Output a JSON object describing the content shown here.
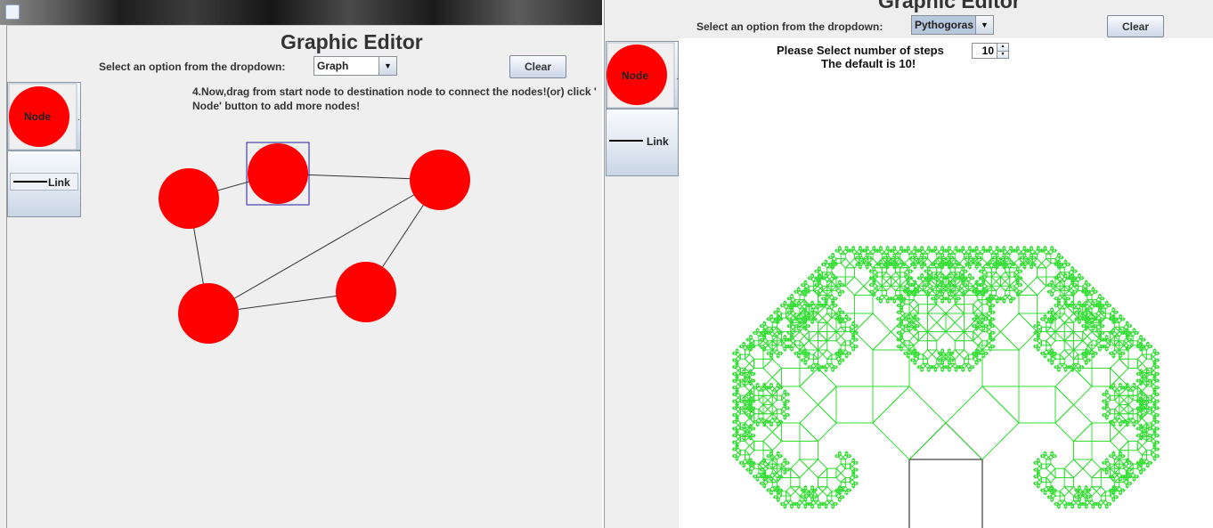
{
  "left_window": {
    "title": "Graphic Editor",
    "dropdown_label": "Select an option from the dropdown:",
    "dropdown_value": "Graph",
    "clear_label": "Clear",
    "node_button_label": "Node",
    "link_button_label": "Link",
    "instruction_line1": "4.Now,drag from start node to destination node to connect the nodes!(or) click '",
    "instruction_line2": "Node' button to add more nodes!",
    "graph": {
      "node_color": "#ff0000",
      "edge_color": "#333333",
      "selection_color": "#1e1ea0",
      "node_count": 5,
      "edge_count": 5,
      "selected_node": 1
    }
  },
  "right_window": {
    "title": "Graphic Editor",
    "dropdown_label": "Select an option from the dropdown:",
    "dropdown_value": "Pythogoras",
    "clear_label": "Clear",
    "node_button_label": "Node",
    "link_button_label": "Link",
    "steps_prompt": "Please Select number of steps",
    "steps_value": "10",
    "default_note": "The default is 10!",
    "tree": {
      "leaf_color": "#33dd33",
      "trunk_color": "#111111",
      "depth": 10
    }
  },
  "icons": [
    "java-icon",
    "chevron-down-icon",
    "spinner-up-icon",
    "spinner-down-icon"
  ]
}
